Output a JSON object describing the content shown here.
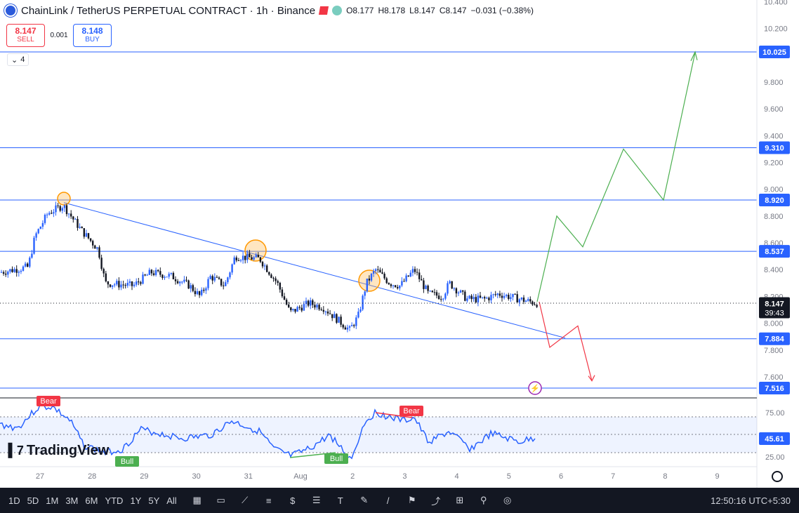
{
  "header": {
    "title": "ChainLink / TetherUS PERPETUAL CONTRACT · 1h · Binance",
    "open": "O8.177",
    "high": "H8.178",
    "low": "L8.147",
    "close": "C8.147",
    "change": "−0.031 (−0.38%)",
    "accent_color": "#f23645"
  },
  "trade": {
    "sell_price": "8.147",
    "sell_label": "SELL",
    "spread": "0.001",
    "buy_price": "8.148",
    "buy_label": "BUY"
  },
  "indicators_count": "4",
  "chart_data": {
    "type": "candlestick",
    "y_axis_ticks": [
      "10.400",
      "10.200",
      "9.800",
      "9.600",
      "9.400",
      "9.200",
      "9.000",
      "8.800",
      "8.600",
      "8.400",
      "8.200",
      "8.000",
      "7.800",
      "7.600"
    ],
    "x_axis_ticks": [
      "27",
      "28",
      "29",
      "30",
      "31",
      "Aug",
      "2",
      "3",
      "4",
      "5",
      "6",
      "7",
      "8",
      "9"
    ],
    "price_levels": [
      {
        "label": "10.025",
        "value": 10.025
      },
      {
        "label": "9.310",
        "value": 9.31
      },
      {
        "label": "8.920",
        "value": 8.92
      },
      {
        "label": "8.537",
        "value": 8.537
      },
      {
        "label": "7.884",
        "value": 7.884
      },
      {
        "label": "7.516",
        "value": 7.516
      }
    ],
    "current_price": {
      "label": "8.147",
      "countdown": "39:43",
      "value": 8.147
    },
    "trendline": {
      "from": {
        "x": 27.45,
        "y": 8.9
      },
      "to": {
        "x": 6.0,
        "y": 7.89
      }
    },
    "bullish_path_values": [
      8.16,
      8.8,
      8.57,
      9.3,
      8.92,
      10.02
    ],
    "bearish_path_values": [
      8.16,
      7.82,
      7.98,
      7.57
    ],
    "line_colors": {
      "levels": "#2962ff",
      "bull_path": "#4caf50",
      "bear_path": "#f23645",
      "candle_up": "#2962ff",
      "candle_down": "#131722"
    }
  },
  "rsi": {
    "ticks": [
      "75.00",
      "25.00"
    ],
    "value": "45.61",
    "labels": {
      "bear1": "Bear",
      "bear2": "Bear",
      "bull1": "Bull",
      "bull2": "Bull"
    }
  },
  "branding": {
    "name": "TradingView"
  },
  "bottombar": {
    "ranges": [
      "1D",
      "5D",
      "1M",
      "3M",
      "6M",
      "YTD",
      "1Y",
      "5Y",
      "All"
    ],
    "clock": "12:50:16 UTC+5:30",
    "tool_icons": [
      "calendar-icon",
      "rectangle-icon",
      "polyline-icon",
      "fib-icon",
      "currency-icon",
      "lines-icon",
      "text-icon",
      "brush-icon",
      "line-icon",
      "flag-icon",
      "path-icon",
      "volume-icon",
      "magic-icon",
      "circle-icon"
    ]
  }
}
